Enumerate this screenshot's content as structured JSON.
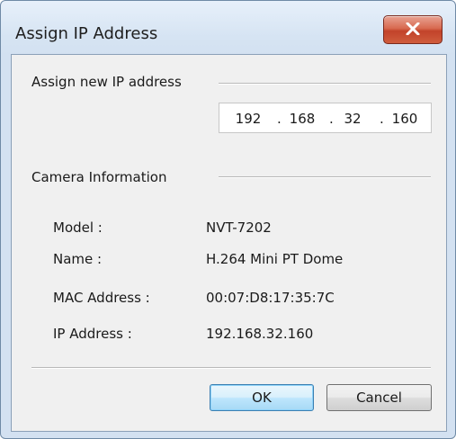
{
  "window": {
    "title": "Assign IP Address"
  },
  "assign_section": {
    "label": "Assign new IP address",
    "ip_octets": [
      "192",
      "168",
      "32",
      "160"
    ],
    "separator": "."
  },
  "camera_section": {
    "label": "Camera Information",
    "rows": [
      {
        "label": "Model :",
        "value": "NVT-7202"
      },
      {
        "label": "Name :",
        "value": "H.264 Mini PT Dome"
      },
      {
        "label": "MAC Address :",
        "value": "00:07:D8:17:35:7C"
      },
      {
        "label": "IP Address :",
        "value": "192.168.32.160"
      }
    ]
  },
  "buttons": {
    "ok_label": "OK",
    "cancel_label": "Cancel"
  },
  "icons": {
    "close": "close-icon"
  },
  "colors": {
    "close_button": "#c2432a",
    "default_button_border": "#3c7fb1",
    "window_frame": "#d3e1f1",
    "client_background": "#f0f0f0"
  }
}
